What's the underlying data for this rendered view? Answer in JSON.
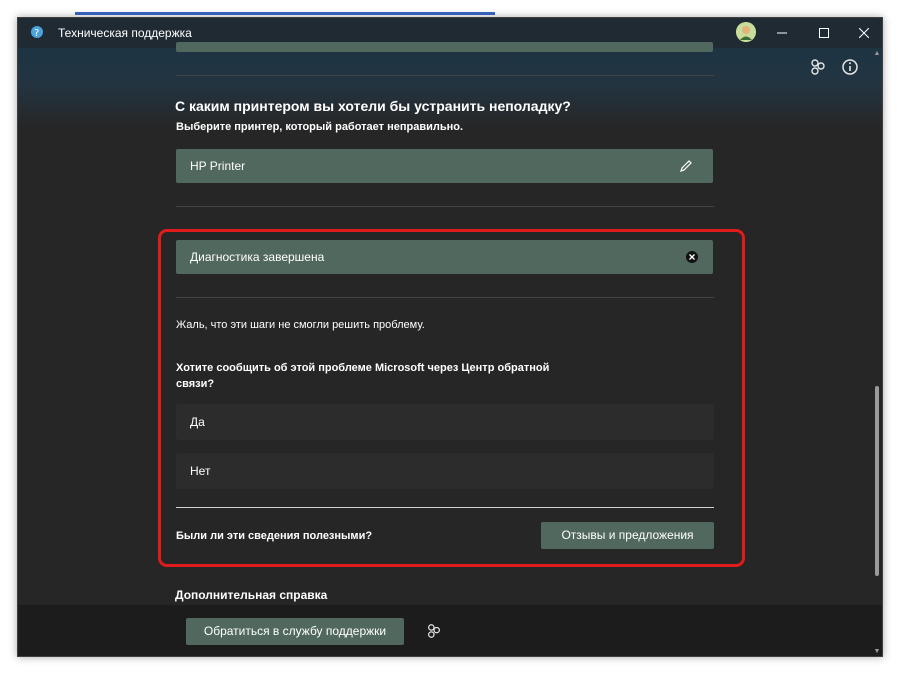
{
  "window": {
    "title": "Техническая поддержка"
  },
  "printer_section": {
    "question": "С каким принтером вы хотели бы устранить неполадку?",
    "hint": "Выберите принтер, который работает неправильно.",
    "selected_printer": "HP Printer"
  },
  "diagnostics": {
    "status": "Диагностика завершена",
    "message": "Жаль, что эти шаги не смогли решить проблему.",
    "feedback_question": "Хотите сообщить об этой проблеме Microsoft через Центр обратной связи?",
    "options": [
      "Да",
      "Нет"
    ],
    "helpful_question": "Были ли эти сведения полезными?",
    "feedback_button": "Отзывы и предложения"
  },
  "more_help": {
    "heading": "Дополнительная справка"
  },
  "footer": {
    "contact_button": "Обратиться в службу поддержки"
  },
  "colors": {
    "accent_field": "#51685f",
    "highlight_frame": "#e01b1b",
    "background": "#262626"
  }
}
